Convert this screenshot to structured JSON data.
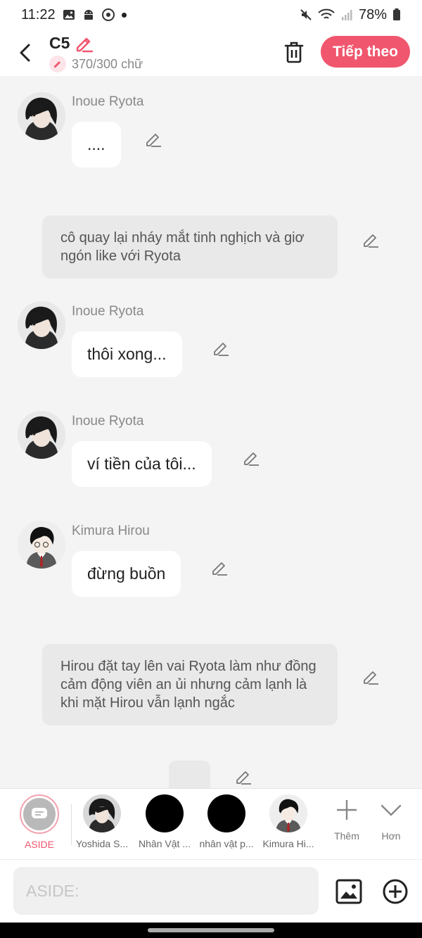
{
  "status_bar": {
    "time": "11:22",
    "battery": "78%"
  },
  "header": {
    "title": "C5",
    "char_count": "370/300 chữ",
    "next_label": "Tiếp theo"
  },
  "messages": [
    {
      "name": "Inoue Ryota",
      "text": "...."
    },
    {
      "narration": "cô quay lại nháy mắt tinh nghịch và giơ ngón like với Ryota"
    },
    {
      "name": "Inoue Ryota",
      "text": "thôi xong..."
    },
    {
      "name": "Inoue Ryota",
      "text": "ví tiền của tôi..."
    },
    {
      "name": "Kimura Hirou",
      "text": "đừng buồn"
    },
    {
      "narration": "Hirou đặt tay lên vai Ryota làm như đồng cảm động viên an ủi nhưng cảm lạnh là khi mặt Hirou vẫn lạnh ngắc"
    }
  ],
  "characters": [
    {
      "label": "ASIDE"
    },
    {
      "label": "Yoshida S..."
    },
    {
      "label": "Nhân Vật ..."
    },
    {
      "label": "nhân vật p..."
    },
    {
      "label": "Kimura Hi..."
    }
  ],
  "tools": {
    "add_label": "Thêm",
    "more_label": "Hơn"
  },
  "composer": {
    "placeholder": "ASIDE:"
  },
  "colors": {
    "accent": "#f0566e",
    "bubble": "#ffffff",
    "narration_bg": "#e9e9e9",
    "background": "#f4f4f4"
  }
}
